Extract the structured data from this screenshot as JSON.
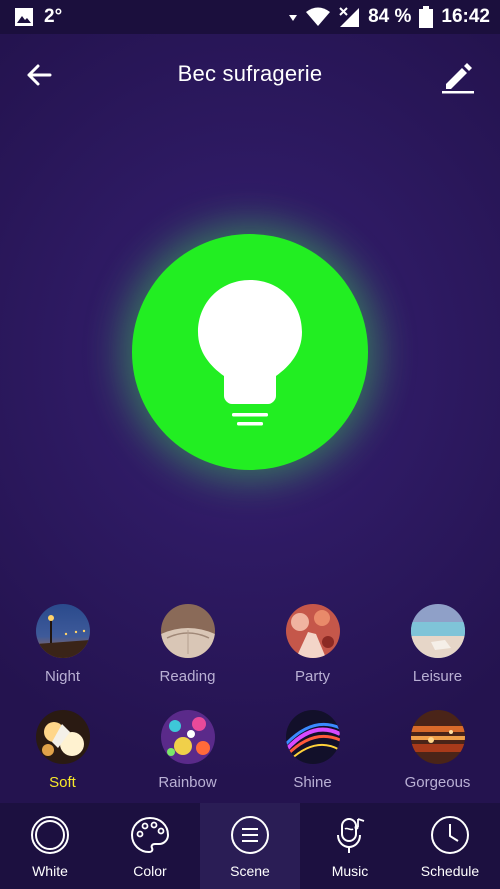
{
  "status_bar": {
    "temperature": "2°",
    "battery_percent": "84 %",
    "time": "16:42",
    "icons": [
      "image-icon",
      "data-arrows-icon",
      "wifi-icon",
      "signal-icon",
      "battery-icon"
    ]
  },
  "header": {
    "title": "Bec sufragerie",
    "back_icon": "arrow-left-icon",
    "edit_icon": "pencil-icon"
  },
  "bulb": {
    "color": "#22ee22",
    "icon": "lightbulb-icon"
  },
  "scenes": [
    {
      "label": "Night",
      "active": false
    },
    {
      "label": "Reading",
      "active": false
    },
    {
      "label": "Party",
      "active": false
    },
    {
      "label": "Leisure",
      "active": false
    },
    {
      "label": "Soft",
      "active": true
    },
    {
      "label": "Rainbow",
      "active": false
    },
    {
      "label": "Shine",
      "active": false
    },
    {
      "label": "Gorgeous",
      "active": false
    }
  ],
  "nav": [
    {
      "label": "White",
      "icon": "ring-icon",
      "active": false
    },
    {
      "label": "Color",
      "icon": "palette-icon",
      "active": false
    },
    {
      "label": "Scene",
      "icon": "scene-list-icon",
      "active": true
    },
    {
      "label": "Music",
      "icon": "microphone-music-icon",
      "active": false
    },
    {
      "label": "Schedule",
      "icon": "clock-icon",
      "active": false
    }
  ],
  "colors": {
    "accent_active_scene": "#f7e82a",
    "background": "#2a1654",
    "nav_background": "#1c1040"
  }
}
